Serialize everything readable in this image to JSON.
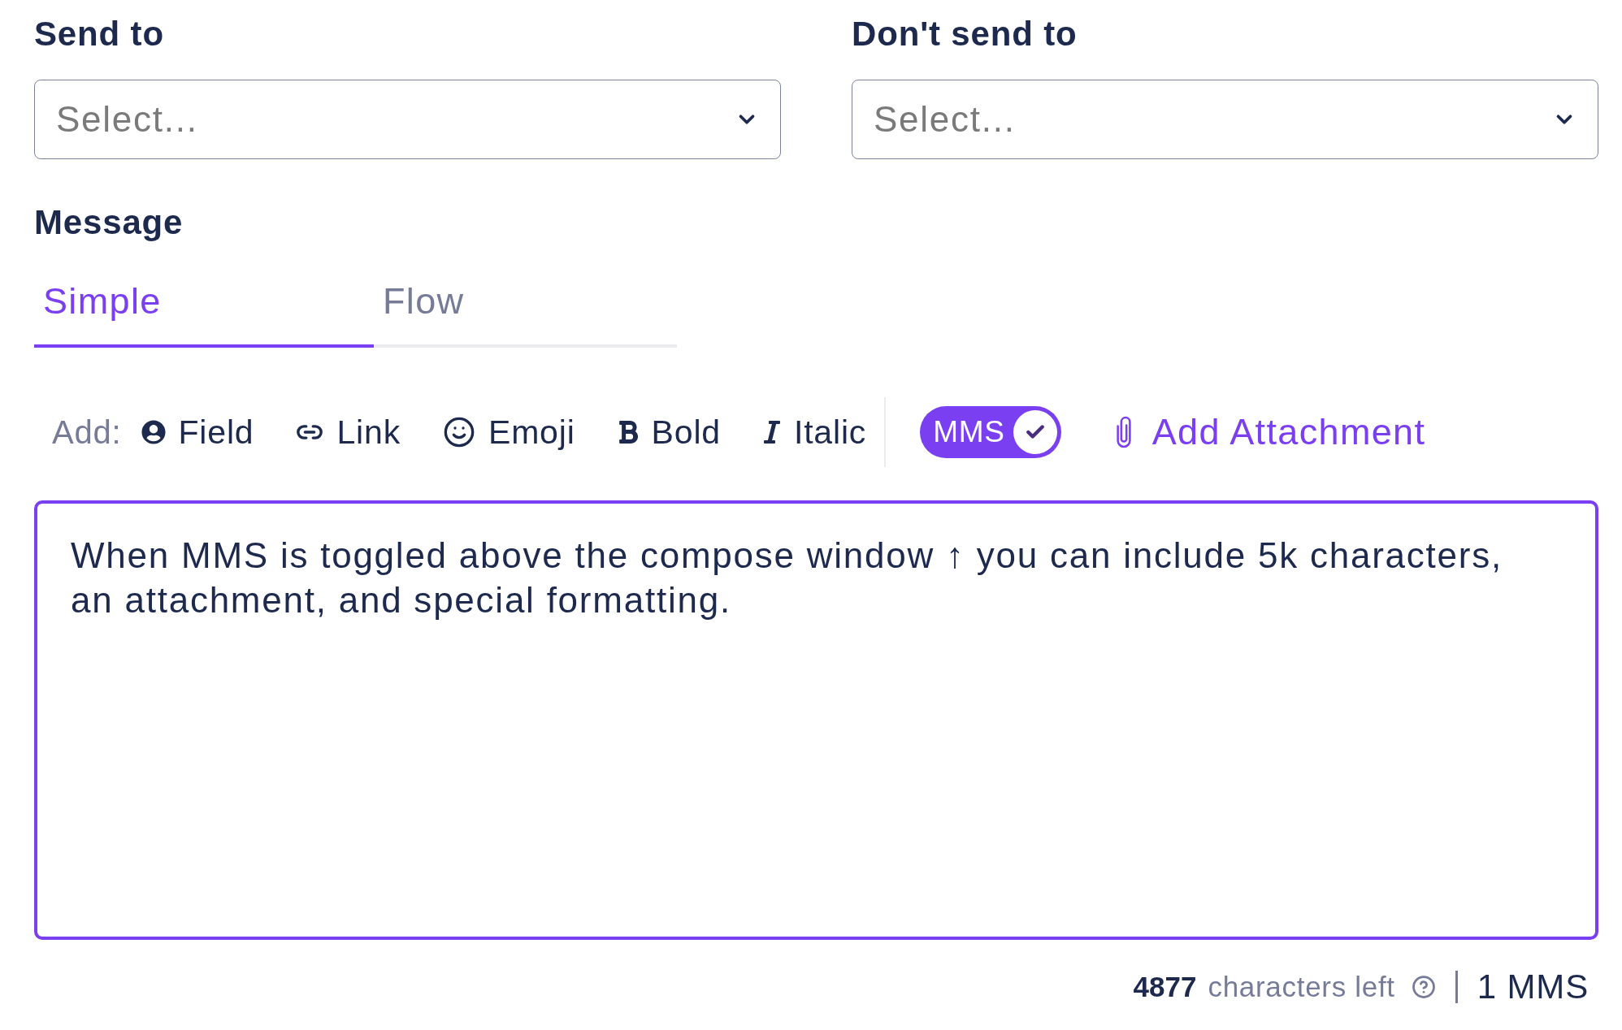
{
  "recipients": [
    {
      "label": "Send to",
      "placeholder": "Select..."
    },
    {
      "label": "Don't send to",
      "placeholder": "Select..."
    }
  ],
  "message": {
    "label": "Message",
    "tabs": [
      {
        "label": "Simple",
        "selected": true
      },
      {
        "label": "Flow",
        "selected": false
      }
    ],
    "toolbar": {
      "add_label": "Add:",
      "items": [
        {
          "kind": "field",
          "label": "Field"
        },
        {
          "kind": "link",
          "label": "Link"
        },
        {
          "kind": "emoji",
          "label": "Emoji"
        },
        {
          "kind": "bold",
          "label": "Bold"
        },
        {
          "kind": "italic",
          "label": "Italic"
        }
      ],
      "mms_toggle": {
        "label": "MMS",
        "on": true
      },
      "attachment": {
        "label": "Add Attachment"
      }
    },
    "body": {
      "value": "When MMS is toggled above the compose window ↑ you can include 5k characters, an attachment, and special formatting."
    }
  },
  "footer": {
    "count": "4877",
    "count_label": "characters left",
    "message_count": "1 MMS"
  }
}
